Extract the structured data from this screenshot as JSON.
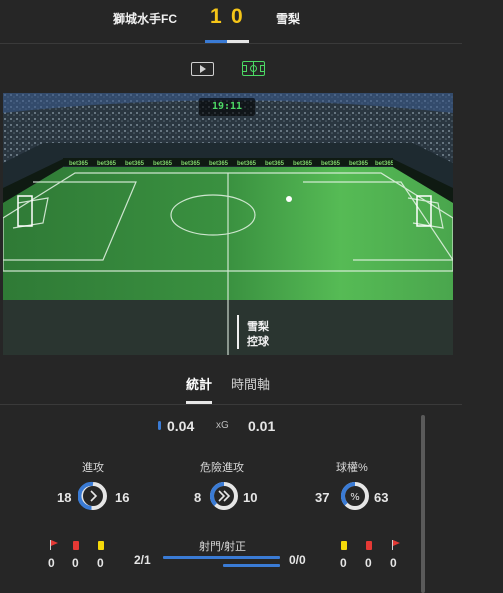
{
  "match": {
    "home_team": "獅城水手FC",
    "away_team": "雪梨",
    "home_score": "1",
    "away_score": "0"
  },
  "view_toggle": {
    "options": [
      "video-icon",
      "pitch-icon"
    ],
    "active": "pitch"
  },
  "pitch": {
    "clock": "19:11",
    "ad_board_text": "bet365",
    "possession_team": "雪梨",
    "possession_label": "控球"
  },
  "tabs": [
    {
      "label": "統計",
      "active": true
    },
    {
      "label": "時間軸",
      "active": false
    }
  ],
  "stats": {
    "xg": {
      "home": "0.04",
      "label": "xG",
      "away": "0.01"
    },
    "gauges": [
      {
        "title": "進攻",
        "home": "18",
        "away": "16",
        "icon": "chevron-right-icon"
      },
      {
        "title": "危險進攻",
        "home": "8",
        "away": "10",
        "icon": "double-chevron-right-icon"
      },
      {
        "title": "球權%",
        "home": "37",
        "away": "63",
        "icon": "percent-icon"
      }
    ],
    "home_events": {
      "corners": "0",
      "red_cards": "0",
      "yellow_cards": "0"
    },
    "away_events": {
      "yellow_cards": "0",
      "red_cards": "0",
      "corners": "0"
    },
    "shots": {
      "title": "射門/射正",
      "home": "2/1",
      "away": "0/0"
    }
  },
  "colors": {
    "background": "#262626",
    "score": "#f5c518",
    "home_accent": "#3a7bd5",
    "clock": "#4cd964",
    "red_card": "#e53935",
    "yellow_card": "#f5d90a"
  }
}
